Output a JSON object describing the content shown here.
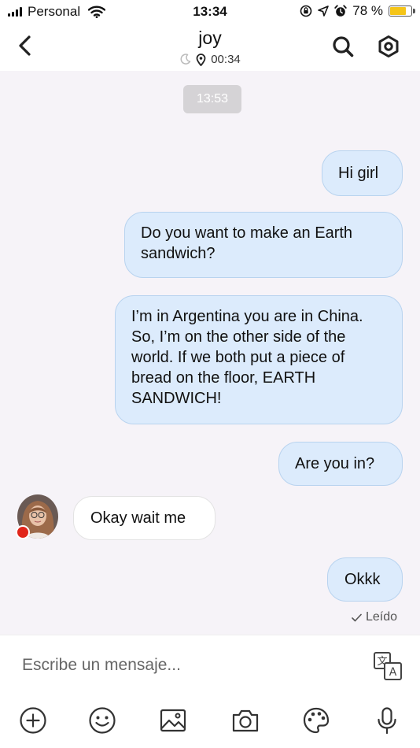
{
  "status_bar": {
    "carrier": "Personal",
    "time": "13:34",
    "battery_percent": "78 %",
    "battery_level": 0.78,
    "battery_color": "#f5c518",
    "icons": [
      "signal-bars-icon",
      "wifi-icon",
      "rotation-lock-icon",
      "location-arrow-icon",
      "alarm-icon",
      "battery-icon"
    ]
  },
  "header": {
    "contact_name": "joy",
    "local_time": "00:34",
    "icons": [
      "back-chevron-icon",
      "moon-icon",
      "location-pin-icon",
      "search-icon",
      "settings-hexagon-icon"
    ]
  },
  "chat": {
    "date_chip": "13:53",
    "messages": [
      {
        "direction": "outgoing",
        "text": "Hi girl"
      },
      {
        "direction": "outgoing",
        "text": "Do you want to make an Earth sandwich?"
      },
      {
        "direction": "outgoing",
        "text": "I’m in Argentina you are in China. So, I’m on the other side of the world. If we both put a piece of bread on the floor, EARTH SANDWICH!"
      },
      {
        "direction": "outgoing",
        "text": "Are you in?"
      },
      {
        "direction": "incoming",
        "text": "Okay wait me"
      },
      {
        "direction": "outgoing",
        "text": "Okkk"
      }
    ],
    "read_status": "Leído",
    "accent_colors": {
      "outgoing_bubble": "#dcebfc",
      "incoming_bubble": "#ffffff",
      "flag": "#e1251b"
    }
  },
  "composer": {
    "placeholder": "Escribe un mensaje...",
    "toolbar": [
      "add-icon",
      "emoji-icon",
      "image-icon",
      "camera-icon",
      "palette-icon",
      "microphone-icon"
    ]
  }
}
